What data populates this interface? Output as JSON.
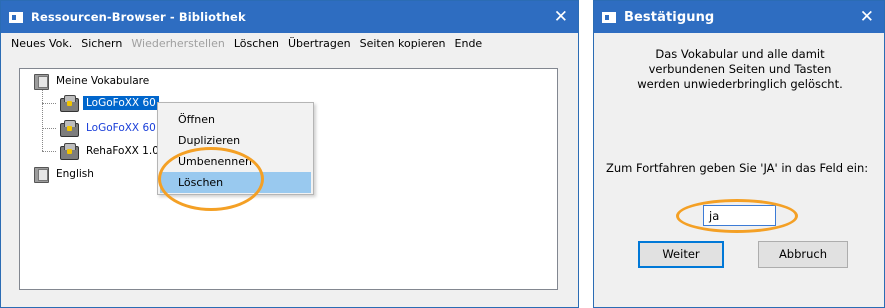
{
  "browser": {
    "title": "Ressourcen-Browser - Bibliothek",
    "close_glyph": "✕",
    "menu": [
      {
        "label": "Neues Vok.",
        "enabled": true
      },
      {
        "label": "Sichern",
        "enabled": true
      },
      {
        "label": "Wiederherstellen",
        "enabled": false
      },
      {
        "label": "Löschen",
        "enabled": true
      },
      {
        "label": "Übertragen",
        "enabled": true
      },
      {
        "label": "Seiten kopieren",
        "enabled": true
      },
      {
        "label": "Ende",
        "enabled": true
      }
    ],
    "tree": {
      "root_label": "Meine Vokabulare",
      "children": [
        {
          "label": "LoGoFoXX 60",
          "state": "selected"
        },
        {
          "label": "LoGoFoXX 60 1",
          "state": "blue"
        },
        {
          "label": "RehaFoXX 1.02",
          "state": "normal"
        }
      ],
      "second_root": "English"
    },
    "context_menu": {
      "items": [
        "Öffnen",
        "Duplizieren",
        "Umbenennen",
        "Löschen"
      ],
      "highlighted": "Löschen"
    }
  },
  "dialog": {
    "title": "Bestätigung",
    "close_glyph": "✕",
    "message_lines": [
      "Das Vokabular und alle damit",
      "verbundenen Seiten und Tasten",
      "werden unwiederbringlich gelöscht."
    ],
    "prompt": "Zum Fortfahren geben Sie 'JA' in das Feld ein:",
    "input_value": "ja",
    "continue_label": "Weiter",
    "cancel_label": "Abbruch"
  },
  "colors": {
    "titlebar": "#2e6dc1",
    "selection": "#0066cc",
    "menu_highlight": "#99c9ef",
    "annotation_ring": "#f4a025"
  }
}
